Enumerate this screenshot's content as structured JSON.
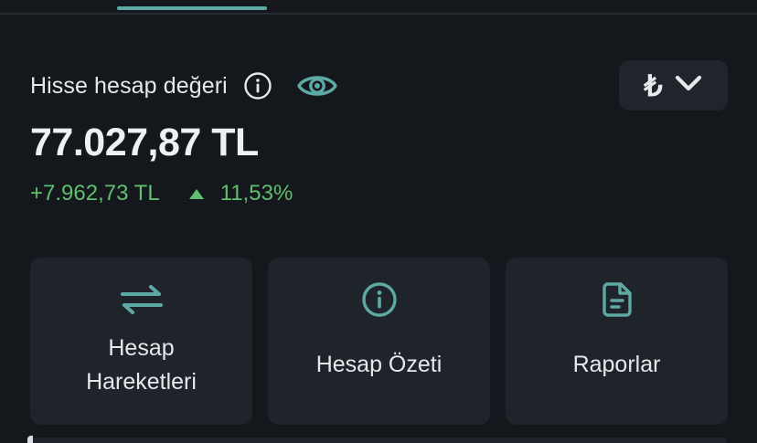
{
  "header": {
    "title": "Hisse hesap değeri",
    "currency_symbol": "₺"
  },
  "account": {
    "balance": "77.027,87 TL",
    "change_amount": "+7.962,73 TL",
    "change_percent": "11,53%",
    "change_direction": "up"
  },
  "actions": [
    {
      "label_line1": "Hesap",
      "label_line2": "Hareketleri",
      "icon": "transfer-arrows-icon"
    },
    {
      "label_line1": "Hesap Özeti",
      "label_line2": "",
      "icon": "info-icon"
    },
    {
      "label_line1": "Raporlar",
      "label_line2": "",
      "icon": "document-icon"
    }
  ],
  "colors": {
    "background": "#14171c",
    "card": "#1f232a",
    "accent": "#5fa9a5",
    "positive": "#5fbf6e",
    "text": "#e6e8ec"
  }
}
